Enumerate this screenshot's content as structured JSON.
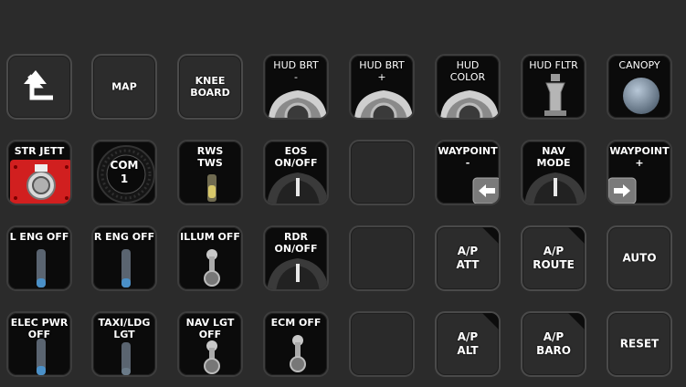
{
  "keys": [
    {
      "label": "",
      "icon": "back-arrow-icon"
    },
    {
      "label": "MAP"
    },
    {
      "label": "KNEE\nBOARD"
    },
    {
      "label": "HUD BRT\n-"
    },
    {
      "label": "HUD BRT\n+"
    },
    {
      "label": "HUD\nCOLOR"
    },
    {
      "label": "HUD FLTR"
    },
    {
      "label": "CANOPY"
    },
    {
      "label": "STR JETT"
    },
    {
      "label": "COM\n1"
    },
    {
      "label": "RWS\nTWS"
    },
    {
      "label": "EOS\nON/OFF"
    },
    {
      "label": ""
    },
    {
      "label": "WAYPOINT\n-"
    },
    {
      "label": "NAV\nMODE"
    },
    {
      "label": "WAYPOINT\n+"
    },
    {
      "label": "L ENG OFF"
    },
    {
      "label": "R ENG OFF"
    },
    {
      "label": "ILLUM OFF"
    },
    {
      "label": "RDR\nON/OFF"
    },
    {
      "label": ""
    },
    {
      "label": "A/P\nATT"
    },
    {
      "label": "A/P\nROUTE"
    },
    {
      "label": "AUTO"
    },
    {
      "label": "ELEC PWR\nOFF"
    },
    {
      "label": "TAXI/LDG\nLGT"
    },
    {
      "label": "NAV LGT\nOFF"
    },
    {
      "label": "ECM OFF"
    },
    {
      "label": ""
    },
    {
      "label": "A/P\nALT"
    },
    {
      "label": "A/P\nBARO"
    },
    {
      "label": "RESET"
    }
  ]
}
